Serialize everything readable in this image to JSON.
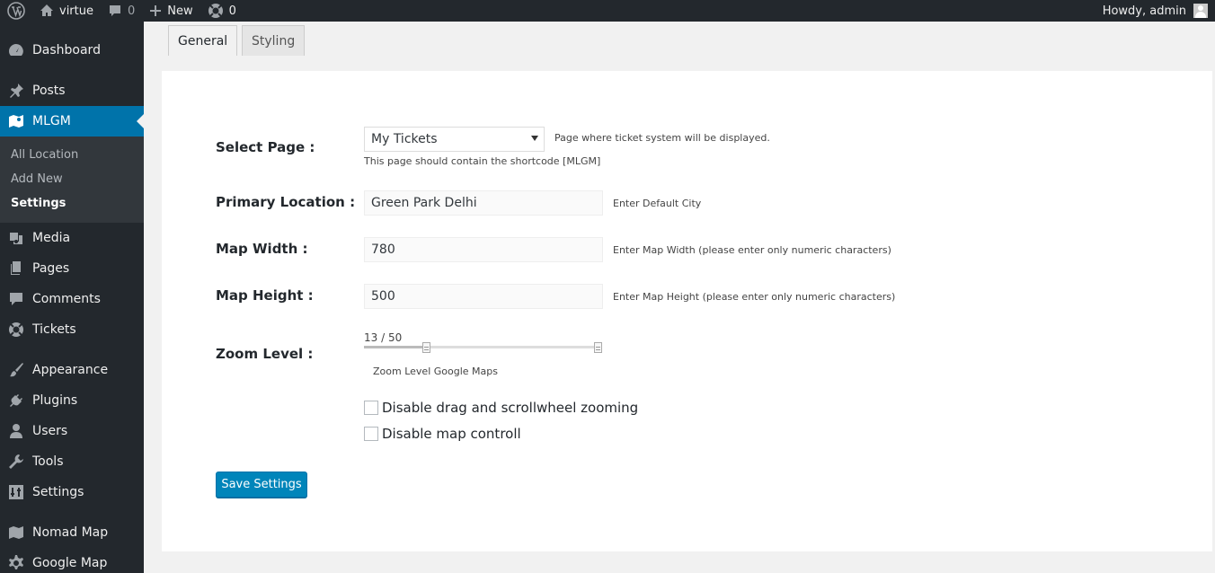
{
  "adminbar": {
    "site_name": "virtue",
    "comments_count": "0",
    "new_label": "New",
    "tickets_count": "0",
    "greeting": "Howdy, admin"
  },
  "sidebar": {
    "items": [
      {
        "label": "Dashboard",
        "icon": "dashboard-icon"
      },
      {
        "label": "Posts",
        "icon": "pin-icon"
      },
      {
        "label": "MLGM",
        "icon": "map-icon"
      },
      {
        "label": "Media",
        "icon": "media-icon"
      },
      {
        "label": "Pages",
        "icon": "pages-icon"
      },
      {
        "label": "Comments",
        "icon": "comment-icon"
      },
      {
        "label": "Tickets",
        "icon": "lifebuoy-icon"
      },
      {
        "label": "Appearance",
        "icon": "brush-icon"
      },
      {
        "label": "Plugins",
        "icon": "plug-icon"
      },
      {
        "label": "Users",
        "icon": "user-icon"
      },
      {
        "label": "Tools",
        "icon": "wrench-icon"
      },
      {
        "label": "Settings",
        "icon": "settings-icon"
      },
      {
        "label": "Nomad Map",
        "icon": "map-icon"
      },
      {
        "label": "Google Map",
        "icon": "gear-icon"
      }
    ],
    "submenu": [
      "All Location",
      "Add New",
      "Settings"
    ]
  },
  "tabs": [
    "General",
    "Styling"
  ],
  "form": {
    "select_page_label": "Select Page :",
    "select_page_value": "My Tickets",
    "select_page_hint": "Page where ticket system will be displayed.",
    "select_page_note": "This page should contain the shortcode [MLGM]",
    "primary_location_label": "Primary Location :",
    "primary_location_value": "Green Park Delhi",
    "primary_location_hint": "Enter Default City",
    "map_width_label": "Map Width :",
    "map_width_value": "780",
    "map_width_hint": "Enter Map Width (please enter only numeric characters)",
    "map_height_label": "Map Height :",
    "map_height_value": "500",
    "map_height_hint": "Enter Map Height (please enter only numeric characters)",
    "zoom_label": "Zoom Level :",
    "zoom_value_text": "13 / 50",
    "zoom_value": 13,
    "zoom_max": 50,
    "zoom_hint": "Zoom Level Google Maps",
    "disable_drag_label": "Disable drag and scrollwheel zooming",
    "disable_controll_label": "Disable map controll",
    "save_label": "Save Settings"
  },
  "colors": {
    "accent": "#0073aa",
    "button": "#0085ba",
    "sidebar_bg": "#23282d",
    "submenu_bg": "#32373c"
  }
}
